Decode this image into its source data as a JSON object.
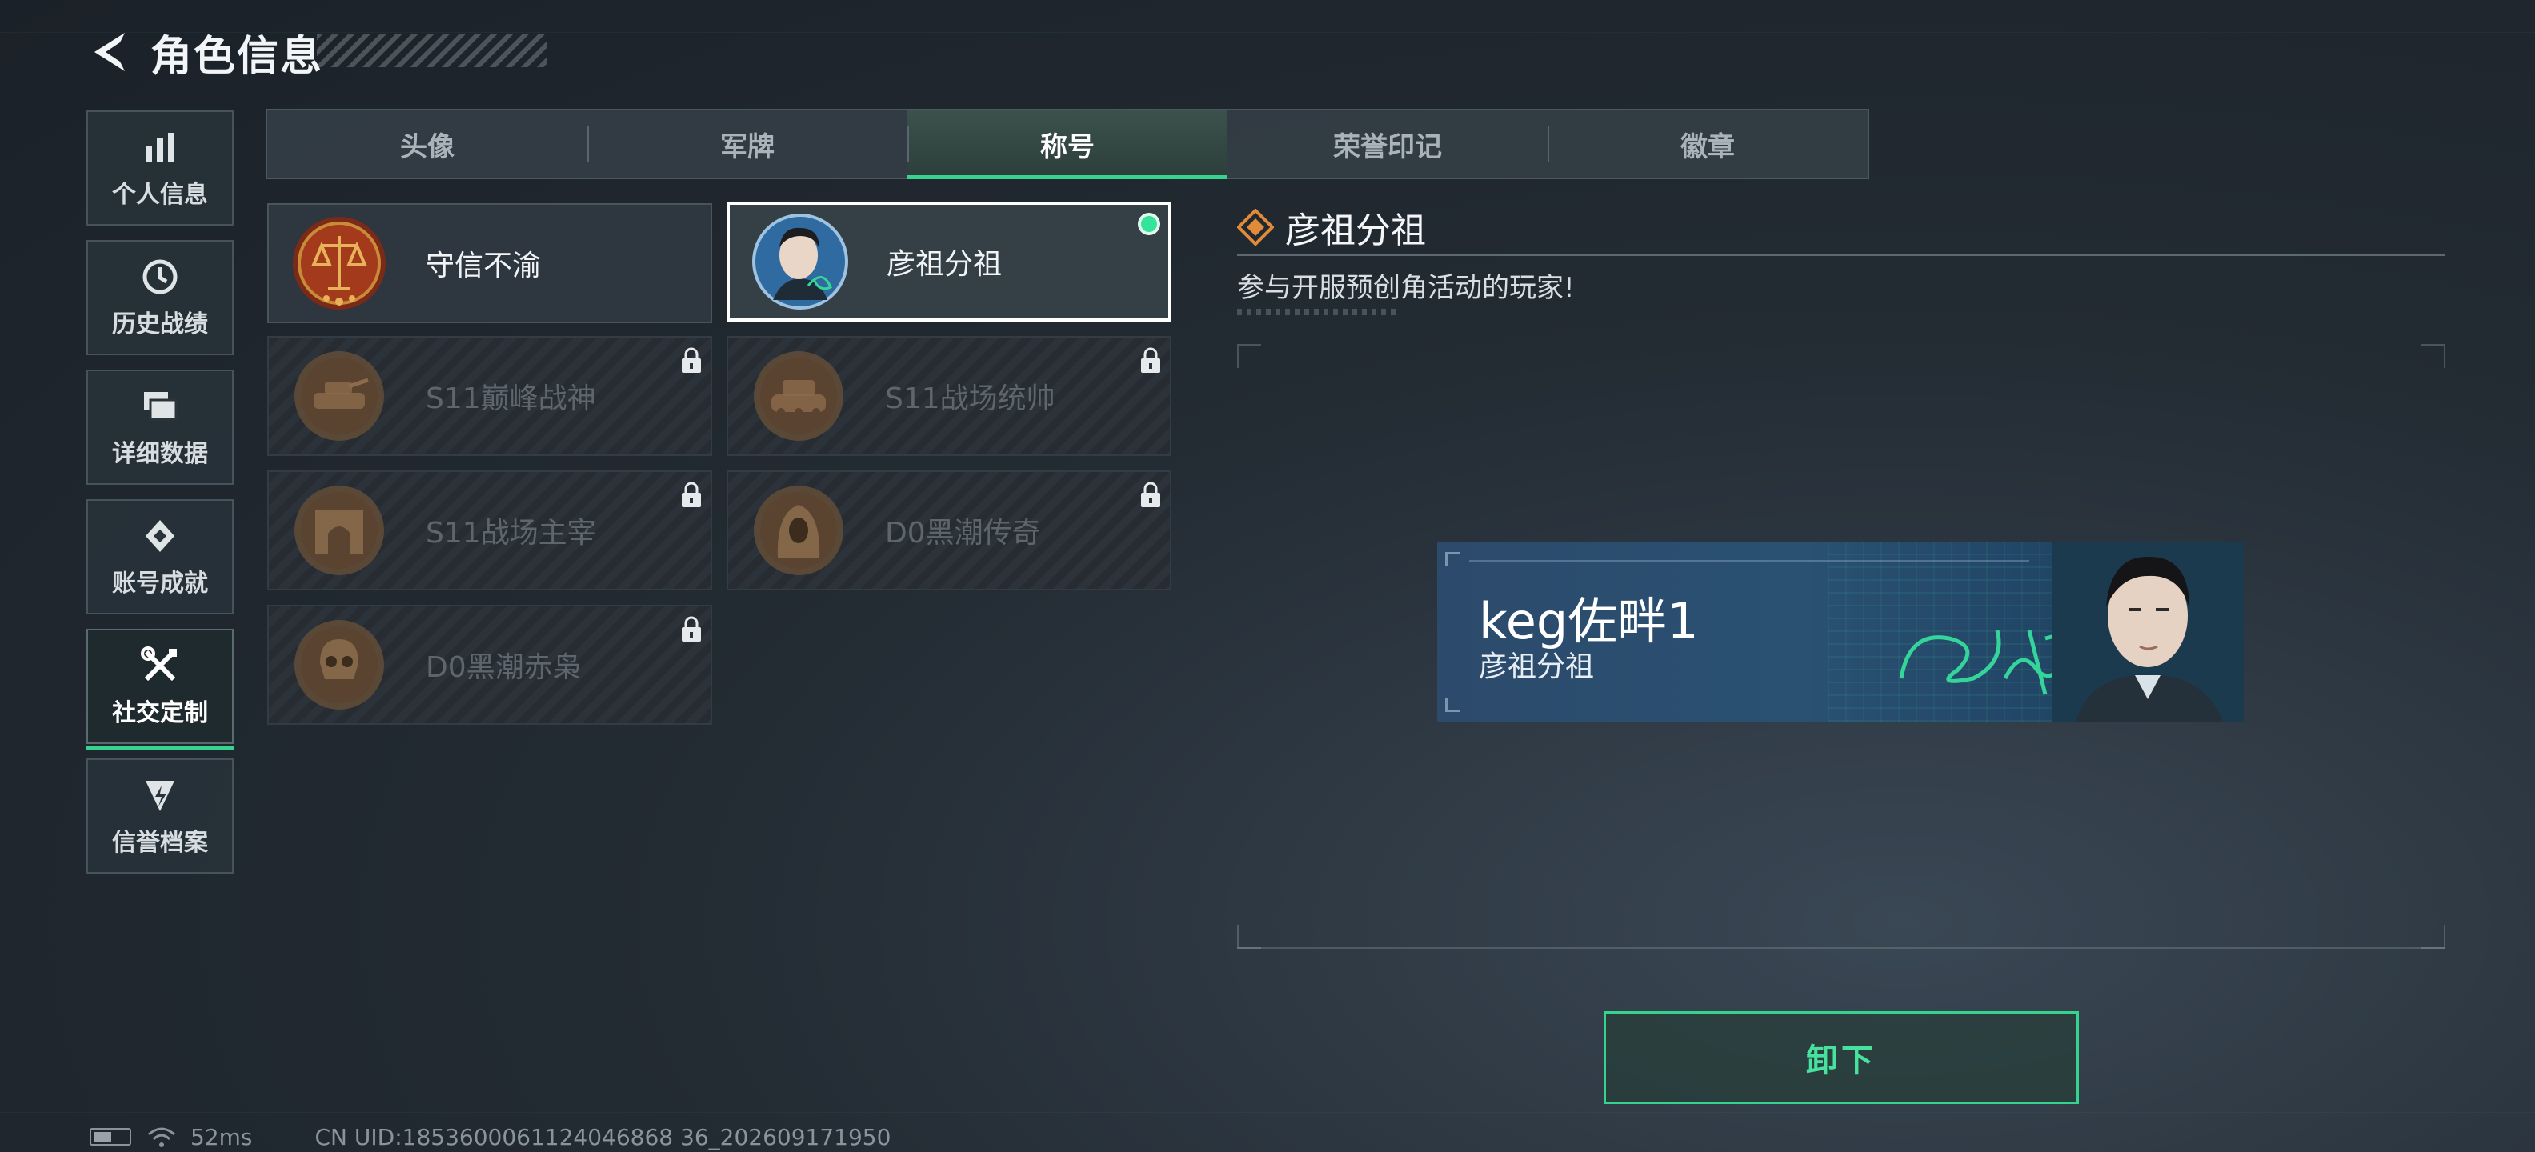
{
  "header": {
    "title": "角色信息"
  },
  "sidebar": {
    "items": [
      {
        "label": "个人信息",
        "icon": "bar-chart-icon"
      },
      {
        "label": "历史战绩",
        "icon": "history-clock-icon"
      },
      {
        "label": "详细数据",
        "icon": "data-cards-icon"
      },
      {
        "label": "账号成就",
        "icon": "achievement-icon"
      },
      {
        "label": "社交定制",
        "icon": "tools-icon",
        "active": true
      },
      {
        "label": "信誉档案",
        "icon": "credit-icon"
      }
    ]
  },
  "tabs": [
    {
      "label": "头像"
    },
    {
      "label": "军牌"
    },
    {
      "label": "称号",
      "active": true
    },
    {
      "label": "荣誉印记"
    },
    {
      "label": "徽章"
    }
  ],
  "titles": [
    {
      "name": "守信不渝",
      "locked": false,
      "emblem": "scales-emblem-icon"
    },
    {
      "name": "彦祖分祖",
      "locked": false,
      "selected": true,
      "equipped": true,
      "emblem": "portrait-emblem-icon"
    },
    {
      "name": "S11巅峰战神",
      "locked": true,
      "emblem": "tank-emblem-icon"
    },
    {
      "name": "S11战场统帅",
      "locked": true,
      "emblem": "tank-emblem-icon"
    },
    {
      "name": "S11战场主宰",
      "locked": true,
      "emblem": "arch-emblem-icon"
    },
    {
      "name": "D0黑潮传奇",
      "locked": true,
      "emblem": "hooded-emblem-icon"
    },
    {
      "name": "D0黑潮赤枭",
      "locked": true,
      "emblem": "skull-emblem-icon"
    }
  ],
  "detail": {
    "title": "彦祖分祖",
    "description": "参与开服预创角活动的玩家!"
  },
  "preview": {
    "player_name": "keg佐畔1",
    "title": "彦祖分祖"
  },
  "actions": {
    "unequip_label": "卸下"
  },
  "status": {
    "ping": "52ms",
    "uid": "CN UID:1853600061124046868 36_202609171950"
  },
  "colors": {
    "accent": "#36d38f",
    "emblem_bronze": "#8a6a4a",
    "emblem_red": "#9c3a1e"
  }
}
